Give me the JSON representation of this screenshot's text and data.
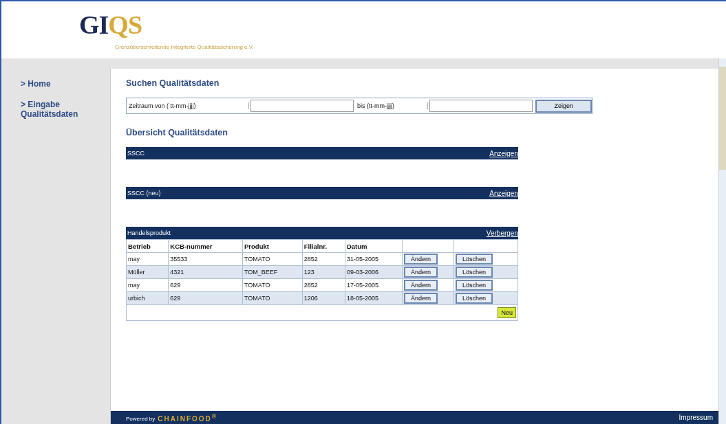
{
  "logo": {
    "text_dark": "GI",
    "text_gold": "QS",
    "tagline": "Grenzüberschreitende Integrierte Qualitätssicherung e.V."
  },
  "sidebar": {
    "items": [
      {
        "label": "> Home"
      },
      {
        "label": "> Eingabe Qualitätsdaten"
      }
    ]
  },
  "search": {
    "title": "Suchen Qualitätsdaten",
    "from_label": "Zeitraum von ( tt-mm-jjjj)",
    "to_label": "bis (tt-mm-jjjj)",
    "button": "Zeigen"
  },
  "overview": {
    "title": "Übersicht Qualitätsdaten",
    "sections": [
      {
        "title": "SSCC",
        "toggle": "Anzeigen",
        "expanded": false
      },
      {
        "title": "SSCC (neu)",
        "toggle": "Anzeigen",
        "expanded": false
      },
      {
        "title": "Handelsprodukt",
        "toggle": "Verbergen",
        "expanded": true
      }
    ]
  },
  "table": {
    "columns": [
      "Betrieb",
      "KCB-nummer",
      "Produkt",
      "Filialnr.",
      "Datum"
    ],
    "rows": [
      {
        "cells": [
          "may",
          "35533",
          "TOMATO",
          "2852",
          "31-05-2005"
        ],
        "edit": "Ändern",
        "delete": "Löschen"
      },
      {
        "cells": [
          "Müller",
          "4321",
          "TOM_BEEF",
          "123",
          "09-03-2006"
        ],
        "edit": "Ändern",
        "delete": "Löschen"
      },
      {
        "cells": [
          "may",
          "629",
          "TOMATO",
          "2852",
          "17-05-2005"
        ],
        "edit": "Ändern",
        "delete": "Löschen"
      },
      {
        "cells": [
          "urbich",
          "629",
          "TOMATO",
          "1206",
          "18-05-2005"
        ],
        "edit": "Ändern",
        "delete": "Löschen"
      }
    ],
    "new_button": "Neu"
  },
  "footer": {
    "powered": "Powered by",
    "brand": "CHAINFOOD",
    "brand_mark": "®",
    "link": "Impressum"
  }
}
